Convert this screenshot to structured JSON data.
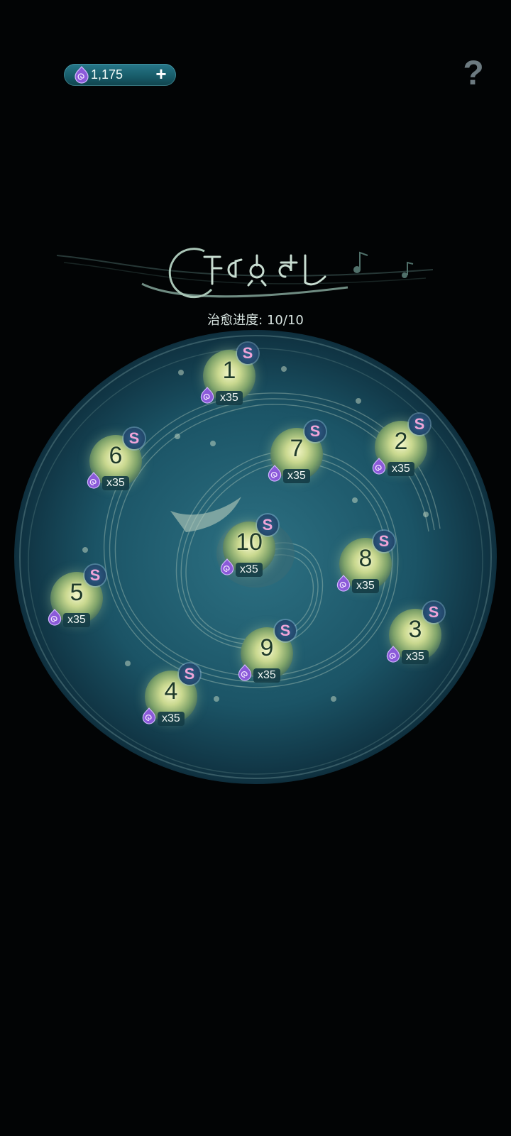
{
  "header": {
    "currency_amount": "1,175",
    "add_label": "+",
    "help_label": "?"
  },
  "progress": {
    "label": "治愈进度",
    "separator": ":",
    "value": "10/10",
    "completed": 10,
    "total": 10
  },
  "nodes": [
    {
      "number": "1",
      "cost": "x35",
      "badge": "S"
    },
    {
      "number": "2",
      "cost": "x35",
      "badge": "S"
    },
    {
      "number": "3",
      "cost": "x35",
      "badge": "S"
    },
    {
      "number": "4",
      "cost": "x35",
      "badge": "S"
    },
    {
      "number": "5",
      "cost": "x35",
      "badge": "S"
    },
    {
      "number": "6",
      "cost": "x35",
      "badge": "S"
    },
    {
      "number": "7",
      "cost": "x35",
      "badge": "S"
    },
    {
      "number": "8",
      "cost": "x35",
      "badge": "S"
    },
    {
      "number": "9",
      "cost": "x35",
      "badge": "S"
    },
    {
      "number": "10",
      "cost": "x35",
      "badge": "S"
    }
  ],
  "colors": {
    "background": "#020405",
    "pool": "#1b5566",
    "currency_pill": "#1d6674",
    "orb_glow": "#e9f2b8",
    "gem": "#8a5ad8"
  },
  "icons": {
    "currency": "purple-swirl-gem-icon",
    "help": "question-mark-icon",
    "badge": "s-rune-icon"
  }
}
